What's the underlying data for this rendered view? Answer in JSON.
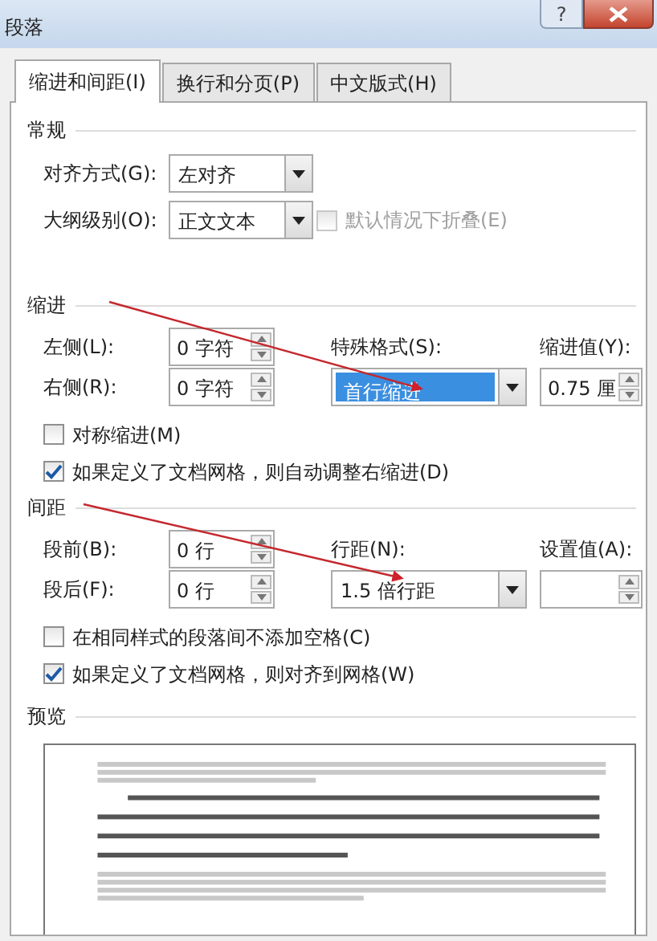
{
  "window": {
    "title": "段落",
    "help": "?"
  },
  "tabs": [
    {
      "label": "缩进和间距(I)",
      "selected": true
    },
    {
      "label": "换行和分页(P)",
      "selected": false
    },
    {
      "label": "中文版式(H)",
      "selected": false
    }
  ],
  "general": {
    "heading": "常规",
    "alignment": {
      "label": "对齐方式(G):",
      "value": "左对齐"
    },
    "outline": {
      "label": "大纲级别(O):",
      "value": "正文文本"
    },
    "collapse": {
      "label": "默认情况下折叠(E)",
      "checked": false,
      "disabled": true
    }
  },
  "indent": {
    "heading": "缩进",
    "left": {
      "label": "左侧(L):",
      "value": "0 字符"
    },
    "right": {
      "label": "右侧(R):",
      "value": "0 字符"
    },
    "special": {
      "label": "特殊格式(S):",
      "value": "首行缩进",
      "highlighted": true
    },
    "by": {
      "label": "缩进值(Y):",
      "value": "0.75 厘"
    },
    "options": [
      {
        "label": "对称缩进(M)",
        "checked": false
      },
      {
        "label": "如果定义了文档网格，则自动调整右缩进(D)",
        "checked": true
      }
    ]
  },
  "spacing": {
    "heading": "间距",
    "before": {
      "label": "段前(B):",
      "value": "0 行"
    },
    "after": {
      "label": "段后(F):",
      "value": "0 行"
    },
    "line": {
      "label": "行距(N):",
      "value": "1.5 倍行距",
      "highlighted": false
    },
    "at": {
      "label": "设置值(A):"
    },
    "options": [
      {
        "label": "在相同样式的段落间不添加空格(C)",
        "checked": false
      },
      {
        "label": "如果定义了文档网格，则对齐到网格(W)",
        "checked": true
      }
    ]
  },
  "preview": {
    "heading": "预览"
  }
}
